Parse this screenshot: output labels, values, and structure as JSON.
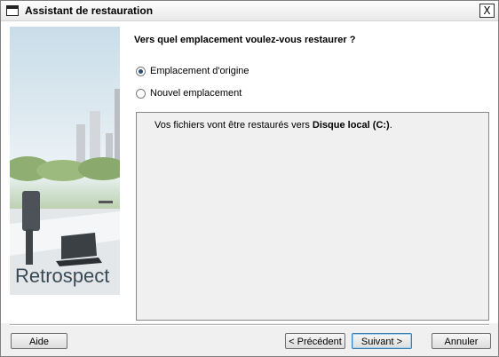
{
  "window": {
    "title": "Assistant de restauration",
    "close_glyph": "X"
  },
  "side": {
    "brand": "Retrospect"
  },
  "question": "Vers quel emplacement voulez-vous restaurer ?",
  "options": [
    {
      "label": "Emplacement d'origine",
      "checked": true
    },
    {
      "label": "Nouvel emplacement",
      "checked": false
    }
  ],
  "info": {
    "prefix": "Vos fichiers vont être restaurés vers ",
    "target": "Disque local (C:)",
    "suffix": "."
  },
  "buttons": {
    "help": "Aide",
    "back": "< Précédent",
    "next": "Suivant >",
    "cancel": "Annuler"
  },
  "colors": {
    "accent": "#3c7fb1",
    "radio_dot": "#2c4b73"
  }
}
